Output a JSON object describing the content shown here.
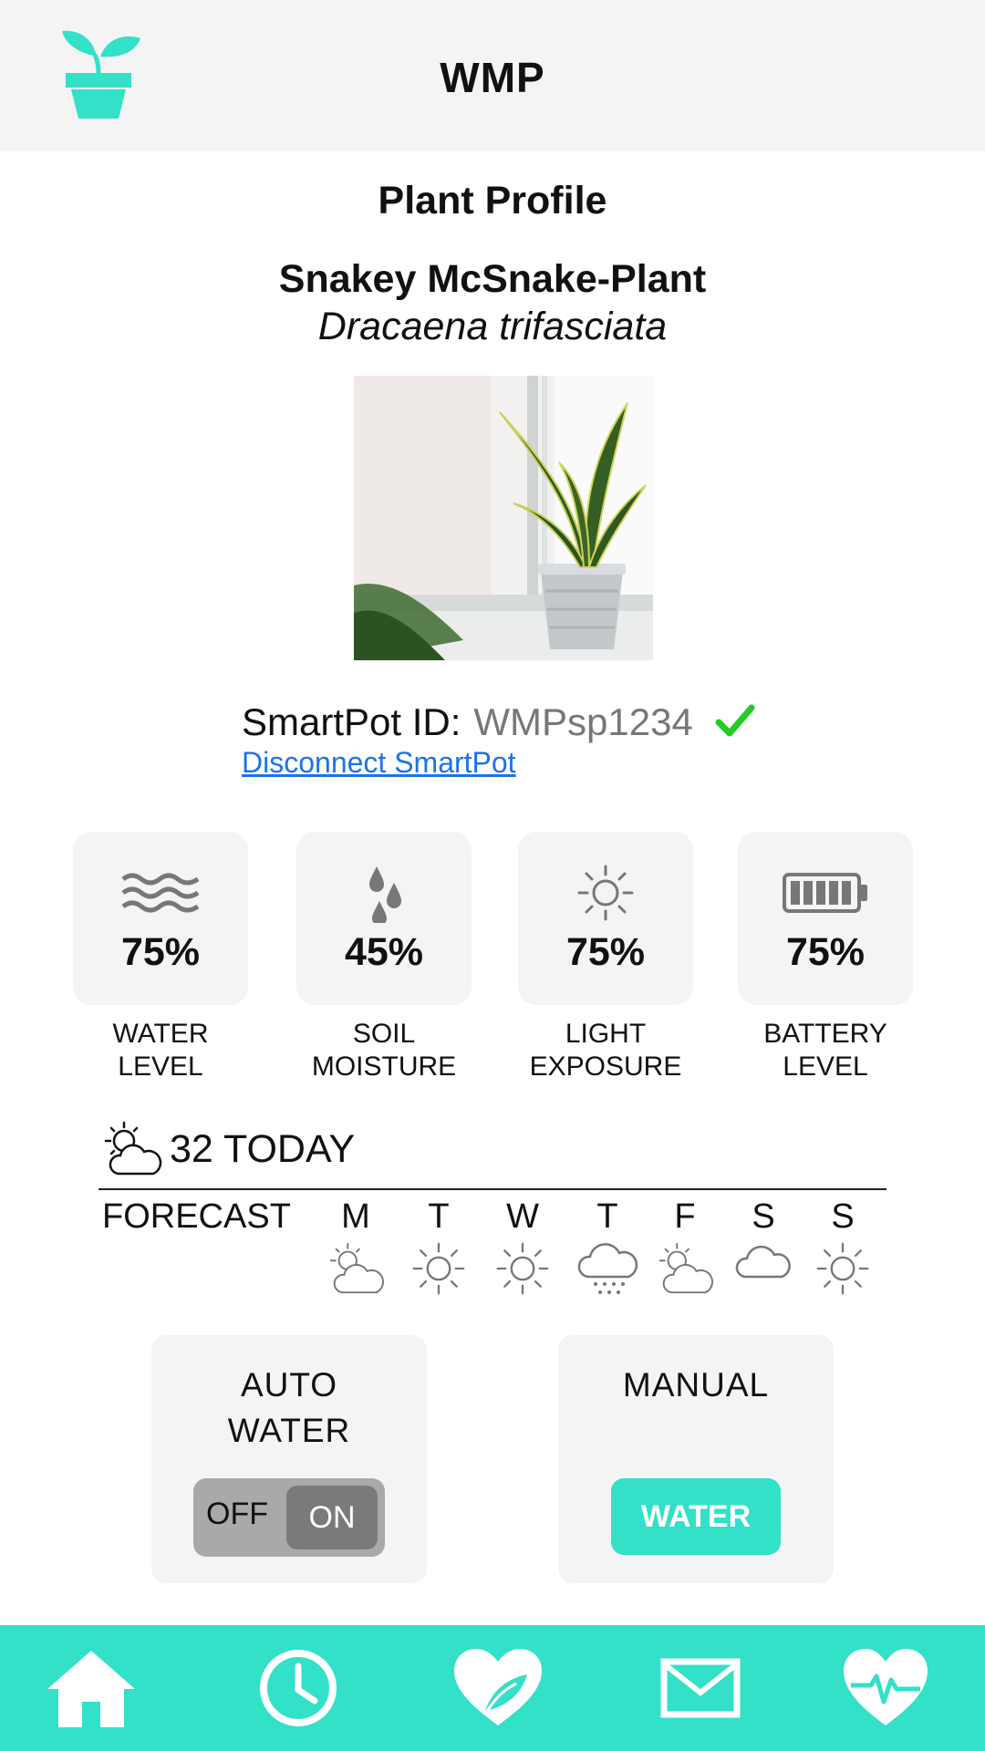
{
  "header": {
    "title": "WMP",
    "logo_icon": "plant-pot-icon"
  },
  "profile": {
    "section_title": "Plant Profile",
    "name": "Snakey McSnake-Plant",
    "species": "Dracaena trifasciata"
  },
  "smartpot": {
    "label": "SmartPot ID:",
    "id": "WMPsp1234",
    "status_icon": "check-icon",
    "disconnect_label": "Disconnect SmartPot"
  },
  "stats": [
    {
      "icon": "water-waves-icon",
      "value": "75%",
      "label_line1": "WATER",
      "label_line2": "LEVEL",
      "level": 75
    },
    {
      "icon": "droplets-icon",
      "value": "45%",
      "label_line1": "SOIL",
      "label_line2": "MOISTURE",
      "level": 45
    },
    {
      "icon": "sun-icon",
      "value": "75%",
      "label_line1": "LIGHT",
      "label_line2": "EXPOSURE",
      "level": 75
    },
    {
      "icon": "battery-icon",
      "value": "75%",
      "label_line1": "BATTERY",
      "label_line2": "LEVEL",
      "level": 75
    }
  ],
  "weather": {
    "today_text": "32 TODAY",
    "today_icon": "partly-cloudy-icon",
    "forecast_label": "FORECAST",
    "days": [
      {
        "day": "M",
        "icon": "partly-cloudy-icon"
      },
      {
        "day": "T",
        "icon": "sun-icon"
      },
      {
        "day": "W",
        "icon": "sun-icon"
      },
      {
        "day": "T",
        "icon": "rain-cloud-icon"
      },
      {
        "day": "F",
        "icon": "partly-cloudy-icon"
      },
      {
        "day": "S",
        "icon": "cloud-icon"
      },
      {
        "day": "S",
        "icon": "sun-icon"
      }
    ]
  },
  "controls": {
    "auto_title_line1": "AUTO",
    "auto_title_line2": "WATER",
    "toggle_off": "OFF",
    "toggle_on": "ON",
    "toggle_state": "ON",
    "manual_title": "MANUAL",
    "water_button": "WATER"
  },
  "nav": [
    "home-icon",
    "clock-icon",
    "plant-heart-icon",
    "mail-icon",
    "heart-pulse-icon"
  ],
  "colors": {
    "accent": "#33e0c8",
    "link": "#1a73e8",
    "check": "#22cc22",
    "card": "#f4f4f4"
  }
}
